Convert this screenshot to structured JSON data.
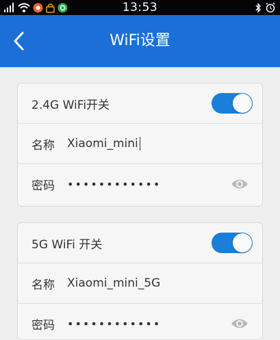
{
  "status_bar": {
    "time": "13:53",
    "icons": [
      "signal-icon",
      "wifi-icon",
      "notification-icon",
      "lock-icon",
      "app-icon",
      "bluetooth-icon",
      "alarm-icon"
    ]
  },
  "app_bar": {
    "title": "WiFi设置",
    "back_icon": "chevron-left-icon"
  },
  "wifi_24g": {
    "toggle_label": "2.4G WiFi开关",
    "toggle_on": true,
    "name_label": "名称",
    "name_value": "Xiaomi_mini",
    "password_label": "密码",
    "password_masked": "••••••••••••"
  },
  "wifi_5g": {
    "toggle_label": "5G WiFi 开关",
    "toggle_on": true,
    "name_label": "名称",
    "name_value": "Xiaomi_mini_5G",
    "password_label": "密码",
    "password_masked": "••••••••••••"
  },
  "colors": {
    "accent": "#1b6fd6",
    "toggle_on": "#1b7ed8",
    "background": "#efefef",
    "card": "#f6f6f6"
  }
}
